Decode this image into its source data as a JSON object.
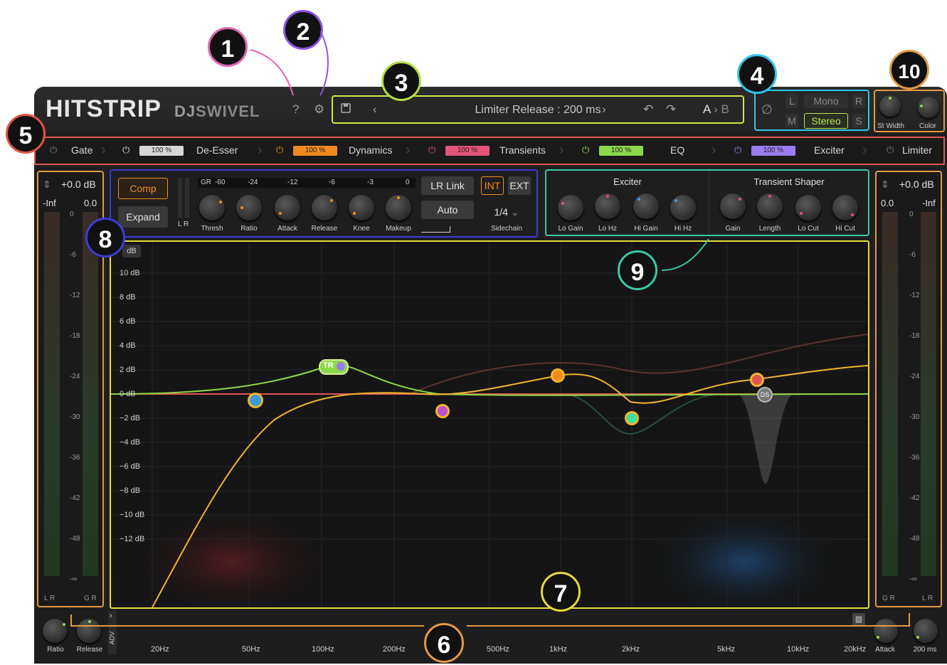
{
  "header": {
    "logo": "HITSTRIP",
    "brand_a": "DJ",
    "brand_b": "SWIVEL",
    "help_icon": "?",
    "settings_icon": "⚙",
    "preset_name": "Limiter Release : 200 ms",
    "ab_a": "A",
    "ab_sep": "›",
    "ab_b": "B"
  },
  "channel": {
    "phase": "∅",
    "l": "L",
    "mono": "Mono",
    "r": "R",
    "m": "M",
    "stereo": "Stereo",
    "s": "S"
  },
  "width_knobs": {
    "st_width": "St Width",
    "color": "Color"
  },
  "modules": [
    {
      "name": "Gate",
      "pct": "",
      "color": "#777777"
    },
    {
      "name": "De-Esser",
      "pct": "100 %",
      "color": "#d6d6d6"
    },
    {
      "name": "Dynamics",
      "pct": "100 %",
      "color": "#f08a1e"
    },
    {
      "name": "Transients",
      "pct": "100 %",
      "color": "#e25478"
    },
    {
      "name": "EQ",
      "pct": "100 %",
      "color": "#8bd84a"
    },
    {
      "name": "Exciter",
      "pct": "100 %",
      "color": "#9b7cf0"
    },
    {
      "name": "Limiter",
      "pct": "",
      "color": "#777777"
    }
  ],
  "meter_left": {
    "db": "+0.0 dB",
    "peak_a": "-Inf",
    "peak_b": "0.0",
    "foot_a": "L R",
    "foot_b": "G R"
  },
  "meter_right": {
    "db": "+0.0 dB",
    "peak_a": "0.0",
    "peak_b": "-Inf",
    "foot_a": "G R",
    "foot_b": "L R"
  },
  "meter_ticks": [
    "0",
    "-6",
    "-12",
    "-18",
    "-24",
    "-30",
    "-36",
    "-42",
    "-48",
    "-∞"
  ],
  "dynamics": {
    "comp": "Comp",
    "expand": "Expand",
    "gr": "GR",
    "gr_scale": [
      "-60",
      "-24",
      "-12",
      "-6",
      "-3",
      "0"
    ],
    "lr": "L  R",
    "knobs": [
      "Thresh",
      "Ratio",
      "Attack",
      "Release",
      "Knee",
      "Makeup"
    ],
    "lr_link": "LR Link",
    "auto": "Auto",
    "int": "INT",
    "ext": "EXT",
    "sidechain_value": "1/4",
    "sidechain": "Sidechain"
  },
  "exciter_panel": {
    "title_a": "Exciter",
    "title_b": "Transient Shaper",
    "knobs_a": [
      "Lo Gain",
      "Lo Hz",
      "Hi Gain",
      "Hi Hz"
    ],
    "knobs_b": [
      "Gain",
      "Length",
      "Lo Cut",
      "Hi Cut"
    ]
  },
  "graph": {
    "db_button": "dB",
    "y_labels": [
      "10 dB",
      "8 dB",
      "6 dB",
      "4 dB",
      "2 dB",
      "0 dB",
      "−2 dB",
      "−4 dB",
      "−6 dB",
      "−8 dB",
      "−10 dB",
      "−12 dB"
    ],
    "tr_tag": "TR",
    "ds_tag": "DS"
  },
  "freq_labels": [
    "20Hz",
    "50Hz",
    "100Hz",
    "200Hz",
    "500Hz",
    "1kHz",
    "2kHz",
    "5kHz",
    "10kHz",
    "20kHz"
  ],
  "bottom": {
    "ratio": "Ratio",
    "release": "Release",
    "adv": "ADV",
    "attack": "Attack",
    "ms": "200 ms"
  },
  "callouts": [
    "1",
    "2",
    "3",
    "4",
    "5",
    "6",
    "7",
    "8",
    "9",
    "10"
  ]
}
